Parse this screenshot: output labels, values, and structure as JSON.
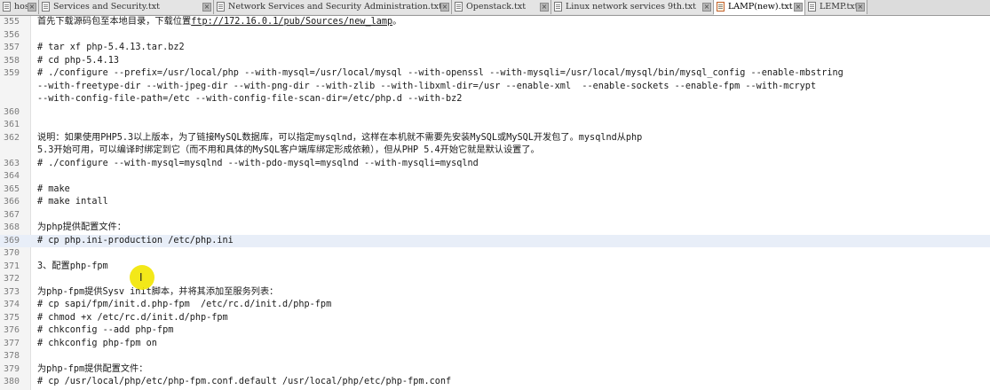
{
  "tabs": [
    {
      "label": "hosts",
      "active": false
    },
    {
      "label": "Services and Security.txt",
      "active": false
    },
    {
      "label": "Network Services and Security Administration.txt",
      "active": false
    },
    {
      "label": "Openstack.txt",
      "active": false
    },
    {
      "label": "Linux network services 9th.txt",
      "active": false
    },
    {
      "label": "LAMP(new).txt",
      "active": true
    },
    {
      "label": "LEMP.txt",
      "active": false
    }
  ],
  "tab_close_glyph": "×",
  "current_line": "369",
  "lines": [
    {
      "n": "355",
      "text": "首先下载源码包至本地目录，下载位置",
      "link": "ftp://172.16.0.1/pub/Sources/new_lamp",
      "after": "。"
    },
    {
      "n": "356",
      "text": ""
    },
    {
      "n": "357",
      "text": "# tar xf php-5.4.13.tar.bz2"
    },
    {
      "n": "358",
      "text": "# cd php-5.4.13"
    },
    {
      "n": "359",
      "text": "# ./configure --prefix=/usr/local/php --with-mysql=/usr/local/mysql --with-openssl --with-mysqli=/usr/local/mysql/bin/mysql_config --enable-mbstring"
    },
    {
      "n": "",
      "text": "--with-freetype-dir --with-jpeg-dir --with-png-dir --with-zlib --with-libxml-dir=/usr --enable-xml  --enable-sockets --enable-fpm --with-mcrypt"
    },
    {
      "n": "",
      "text": "--with-config-file-path=/etc --with-config-file-scan-dir=/etc/php.d --with-bz2"
    },
    {
      "n": "360",
      "text": ""
    },
    {
      "n": "361",
      "text": ""
    },
    {
      "n": "362",
      "text": "说明：如果使用PHP5.3以上版本，为了链接MySQL数据库，可以指定mysqlnd，这样在本机就不需要先安装MySQL或MySQL开发包了。mysqlnd从php"
    },
    {
      "n": "",
      "text": "5.3开始可用，可以编译时绑定到它（而不用和具体的MySQL客户端库绑定形成依赖），但从PHP 5.4开始它就是默认设置了。"
    },
    {
      "n": "363",
      "text": "# ./configure --with-mysql=mysqlnd --with-pdo-mysql=mysqlnd --with-mysqli=mysqlnd"
    },
    {
      "n": "364",
      "text": ""
    },
    {
      "n": "365",
      "text": "# make"
    },
    {
      "n": "366",
      "text": "# make intall"
    },
    {
      "n": "367",
      "text": ""
    },
    {
      "n": "368",
      "text": "为php提供配置文件："
    },
    {
      "n": "369",
      "text": "# cp php.ini-production /etc/php.ini"
    },
    {
      "n": "370",
      "text": ""
    },
    {
      "n": "371",
      "text": "3、配置php-fpm"
    },
    {
      "n": "372",
      "text": ""
    },
    {
      "n": "373",
      "text": "为php-fpm提供Sysv init脚本，并将其添加至服务列表："
    },
    {
      "n": "374",
      "text": "# cp sapi/fpm/init.d.php-fpm  /etc/rc.d/init.d/php-fpm"
    },
    {
      "n": "375",
      "text": "# chmod +x /etc/rc.d/init.d/php-fpm"
    },
    {
      "n": "376",
      "text": "# chkconfig --add php-fpm"
    },
    {
      "n": "377",
      "text": "# chkconfig php-fpm on"
    },
    {
      "n": "378",
      "text": ""
    },
    {
      "n": "379",
      "text": "为php-fpm提供配置文件："
    },
    {
      "n": "380",
      "text": "# cp /usr/local/php/etc/php-fpm.conf.default /usr/local/php/etc/php-fpm.conf"
    }
  ],
  "caret_glyph": "I",
  "colors": {
    "current_line": "#e8eef8",
    "cursor_highlight": "#f2e600"
  }
}
